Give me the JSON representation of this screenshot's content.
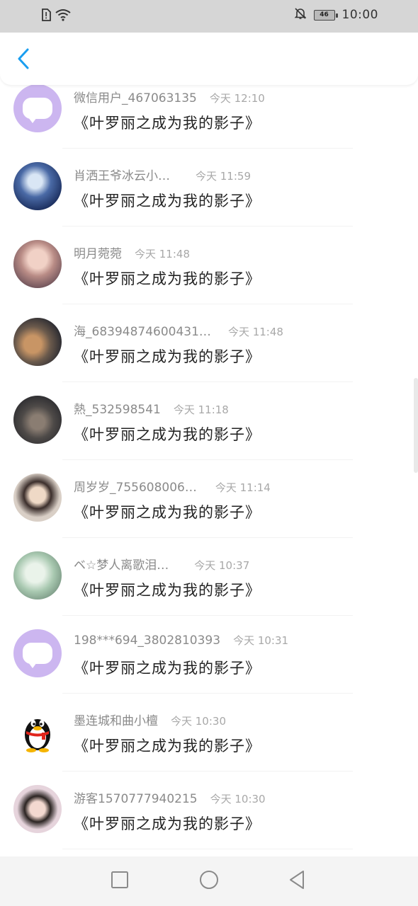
{
  "status_bar": {
    "time": "10:00",
    "battery": "46",
    "icons": [
      "sim-alert-icon",
      "wifi-icon",
      "bell-off-icon",
      "battery-icon"
    ]
  },
  "header": {
    "back_icon": "chevron-left-icon",
    "accent": "#1a9ef0"
  },
  "comments": [
    {
      "name": "微信用户_467063135",
      "time": "今天 12:10",
      "content": "《叶罗丽之成为我的影子》",
      "avatar": "wechat-default-avatar"
    },
    {
      "name": "肖洒王爷冰云小…",
      "time": "今天 11:59",
      "content": "《叶罗丽之成为我的影子》",
      "avatar": "user-avatar"
    },
    {
      "name": "明月菀菀",
      "time": "今天 11:48",
      "content": "《叶罗丽之成为我的影子》",
      "avatar": "user-avatar"
    },
    {
      "name": "海_68394874600431…",
      "time": "今天 11:48",
      "content": "《叶罗丽之成为我的影子》",
      "avatar": "user-avatar"
    },
    {
      "name": "熱_532598541",
      "time": "今天 11:18",
      "content": "《叶罗丽之成为我的影子》",
      "avatar": "user-avatar"
    },
    {
      "name": "周岁岁_755608006…",
      "time": "今天 11:14",
      "content": "《叶罗丽之成为我的影子》",
      "avatar": "user-avatar"
    },
    {
      "name": "ベ☆梦人离歌泪…",
      "time": "今天 10:37",
      "content": "《叶罗丽之成为我的影子》",
      "avatar": "user-avatar"
    },
    {
      "name": "198***694_3802810393",
      "time": "今天 10:31",
      "content": "《叶罗丽之成为我的影子》",
      "avatar": "wechat-default-avatar"
    },
    {
      "name": "墨连城和曲小檀",
      "time": "今天 10:30",
      "content": "《叶罗丽之成为我的影子》",
      "avatar": "qq-penguin-avatar"
    },
    {
      "name": "游客1570777940215",
      "time": "今天 10:30",
      "content": "《叶罗丽之成为我的影子》",
      "avatar": "user-avatar"
    }
  ],
  "nav_bar": {
    "items": [
      "recent-apps-icon",
      "home-icon",
      "back-icon"
    ]
  }
}
